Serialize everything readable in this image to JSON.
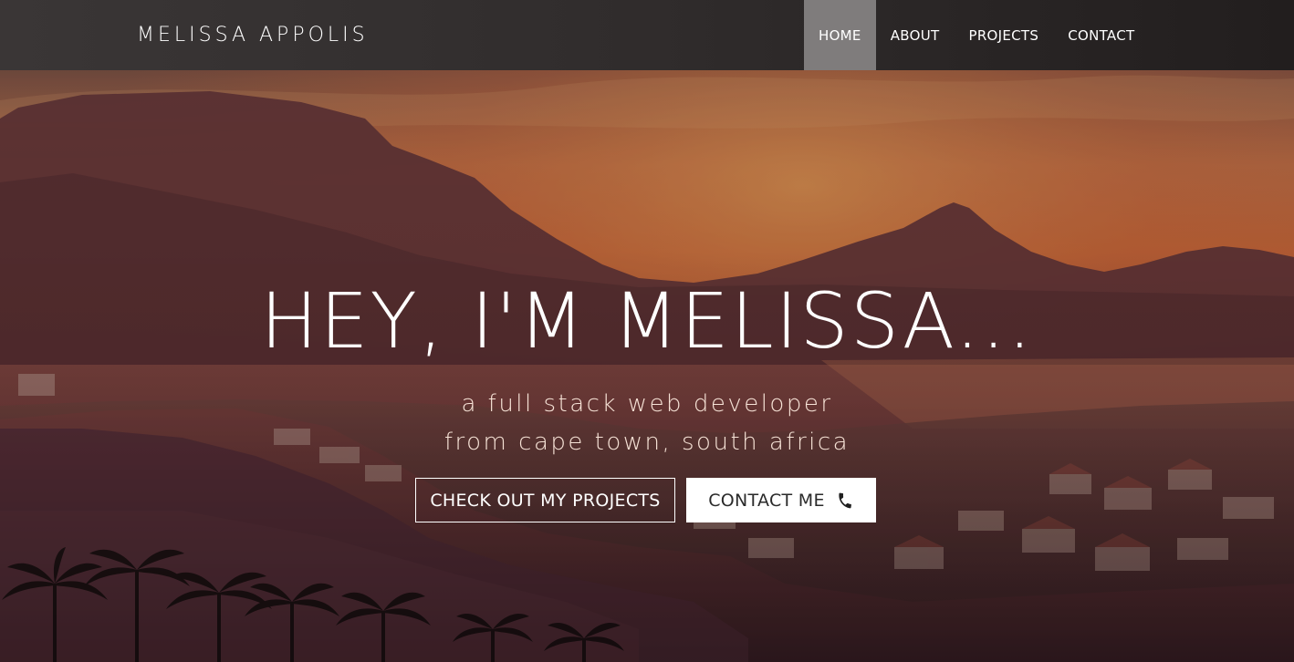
{
  "brand": {
    "name": "MELISSA APPOLIS"
  },
  "nav": {
    "items": [
      {
        "label": "HOME",
        "active": true
      },
      {
        "label": "ABOUT",
        "active": false
      },
      {
        "label": "PROJECTS",
        "active": false
      },
      {
        "label": "CONTACT",
        "active": false
      }
    ]
  },
  "hero": {
    "title": "HEY, I'M MELISSA...",
    "subtitle_line1": "a full stack web developer",
    "subtitle_line2": "from cape town, south africa",
    "projects_button": "CHECK OUT MY PROJECTS",
    "contact_button": "CONTACT ME",
    "contact_icon": "phone-icon"
  },
  "colors": {
    "navbar": "#2e2a2a",
    "nav_active": "#7f7c7c",
    "sky_top": "#5a3b3f",
    "sky_glow": "#e06a3e",
    "text": "#ffffff"
  }
}
